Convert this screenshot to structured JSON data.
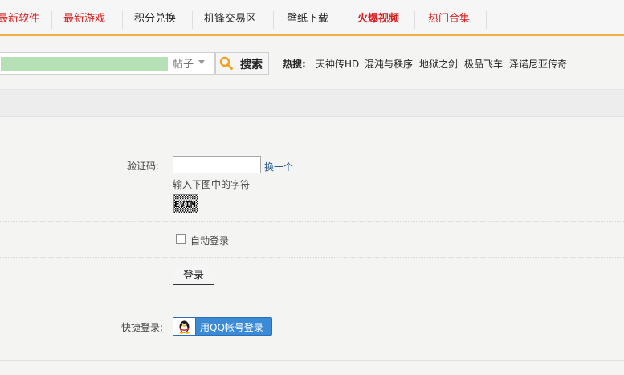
{
  "nav": {
    "items": [
      {
        "label": "最新软件",
        "color": "#d62020",
        "bold": false
      },
      {
        "label": "最新游戏",
        "color": "#d62020",
        "bold": false
      },
      {
        "label": "积分兑换",
        "color": "#222222",
        "bold": false
      },
      {
        "label": "机锋交易区",
        "color": "#222222",
        "bold": false
      },
      {
        "label": "壁纸下载",
        "color": "#222222",
        "bold": false
      },
      {
        "label": "火爆视频",
        "color": "#d62020",
        "bold": true
      },
      {
        "label": "热门合集",
        "color": "#d62020",
        "bold": false
      }
    ],
    "accent_color": "#f2b043"
  },
  "search": {
    "value": "",
    "type_label": "帖子",
    "button_label": "搜索",
    "hot_label": "热搜:",
    "hot_links": [
      "天神传HD",
      "混沌与秩序",
      "地狱之剑",
      "极品飞车",
      "泽诺尼亚传奇"
    ]
  },
  "form": {
    "captcha_label": "验证码:",
    "captcha_value": "",
    "refresh_link": "换一个",
    "captcha_hint": "输入下图中的字符",
    "captcha_image_text": "EVIM",
    "auto_login_label": "自动登录",
    "auto_login_checked": false,
    "login_button": "登录",
    "quick_login_label": "快捷登录:",
    "qq_button": "用QQ帐号登录"
  },
  "icons": {
    "search": "magnifier-icon",
    "qq": "qq-penguin-icon"
  }
}
